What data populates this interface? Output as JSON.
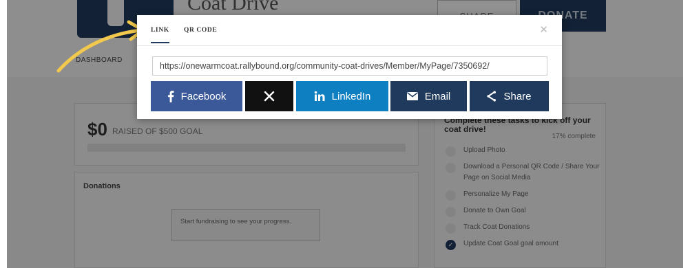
{
  "background_page": {
    "campaign_title": "Coat Drive",
    "share_label": "SHARE",
    "donate_label": "DONATE",
    "nav_dashboard": "DASHBOARD",
    "raised_amount": "$0",
    "raised_text": "RAISED OF $500 GOAL",
    "goal_progress": 0,
    "donations_title": "Donations",
    "donations_empty": "Start fundraising to see your progress.",
    "tasks_title": "Complete these tasks to kick off your coat drive!",
    "tasks_complete": "17% complete",
    "tasks": [
      {
        "label": "Upload Photo",
        "done": false
      },
      {
        "label": "Download a Personal QR Code / Share Your Page on Social Media",
        "done": false
      },
      {
        "label": "Personalize My Page",
        "done": false
      },
      {
        "label": "Donate to Own Goal",
        "done": false
      },
      {
        "label": "Track Coat Donations",
        "done": false
      },
      {
        "label": "Update Coat Goal goal amount",
        "done": true
      }
    ]
  },
  "modal": {
    "tabs": [
      {
        "label": "LINK",
        "active": true
      },
      {
        "label": "QR CODE",
        "active": false
      }
    ],
    "close_icon": "close-icon",
    "share_url": "https://onewarmcoat.rallybound.org/community-coat-drives/Member/MyPage/7350692/",
    "buttons": {
      "facebook": {
        "label": "Facebook",
        "icon": "facebook-icon",
        "color": "#3b5998"
      },
      "x": {
        "label": "",
        "icon": "x-logo-icon",
        "color": "#111111"
      },
      "linkedin": {
        "label": "LinkedIn",
        "icon": "linkedin-icon",
        "color": "#0e7fc0"
      },
      "email": {
        "label": "Email",
        "icon": "envelope-icon",
        "color": "#1f3a5c"
      },
      "share": {
        "label": "Share",
        "icon": "share-icon",
        "color": "#1f3a5c"
      }
    }
  },
  "annotation": {
    "arrow_color": "#f2c94c"
  }
}
